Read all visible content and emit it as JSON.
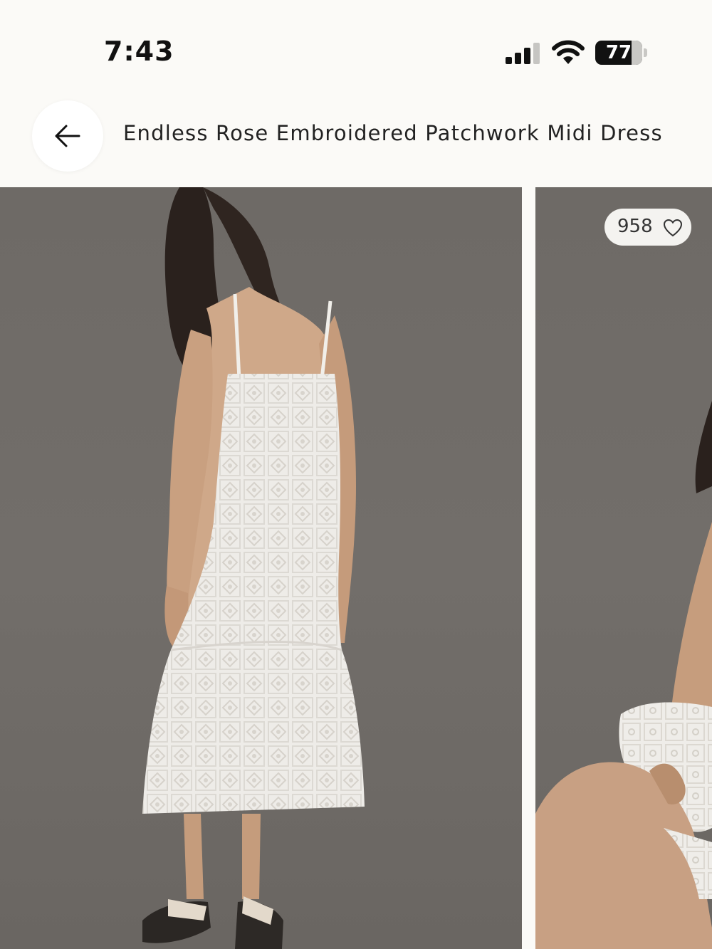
{
  "status_bar": {
    "time": "7:43",
    "battery_level": "77",
    "battery_fraction": 0.77,
    "icons": [
      "signal-icon",
      "wifi-icon",
      "battery-icon"
    ]
  },
  "header": {
    "back_icon": "arrow-left-icon",
    "title": "Endless Rose Embroidered Patchwork Midi Dress"
  },
  "gallery": {
    "likes": "958",
    "likes_icon": "heart-outline-icon",
    "background_color": "#6e6a66"
  }
}
